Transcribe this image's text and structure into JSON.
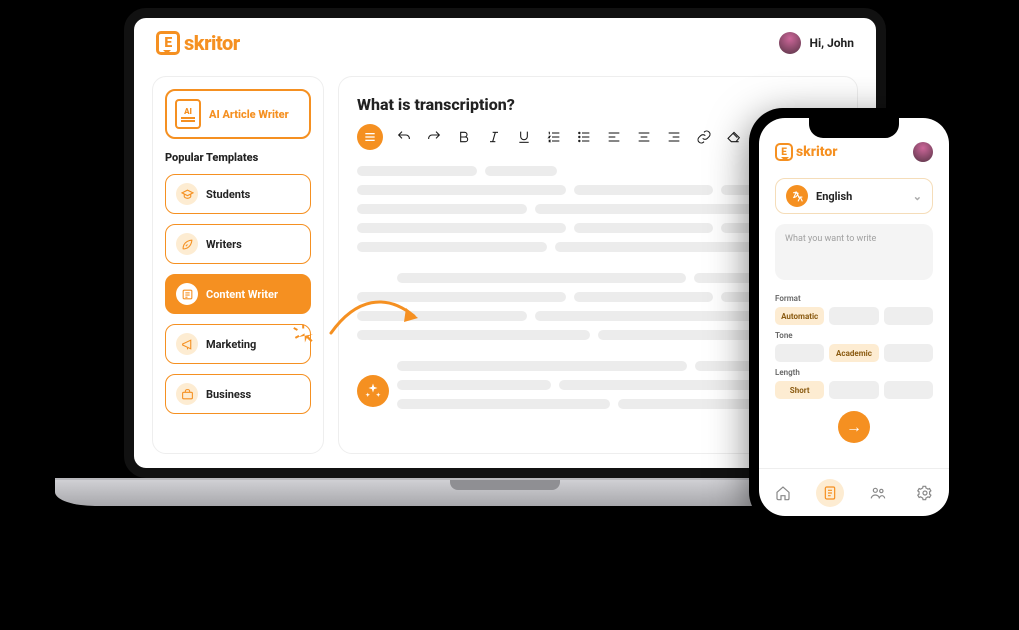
{
  "brand": "skritor",
  "brand_e": "E",
  "desktop": {
    "greeting": "Hi, John",
    "ai_writer_label": "AI Article Writer",
    "ai_icon_text": "AI",
    "popular_label": "Popular Templates",
    "templates": [
      {
        "label": "Students"
      },
      {
        "label": "Writers"
      },
      {
        "label": "Content Writer"
      },
      {
        "label": "Marketing"
      },
      {
        "label": "Business"
      }
    ],
    "editor_title": "What is transcription?"
  },
  "mobile": {
    "language": "English",
    "prompt_placeholder": "What you want to write",
    "sections": {
      "format": {
        "label": "Format",
        "selected": "Automatic"
      },
      "tone": {
        "label": "Tone",
        "selected": "Academic"
      },
      "length": {
        "label": "Length",
        "selected": "Short"
      }
    }
  }
}
